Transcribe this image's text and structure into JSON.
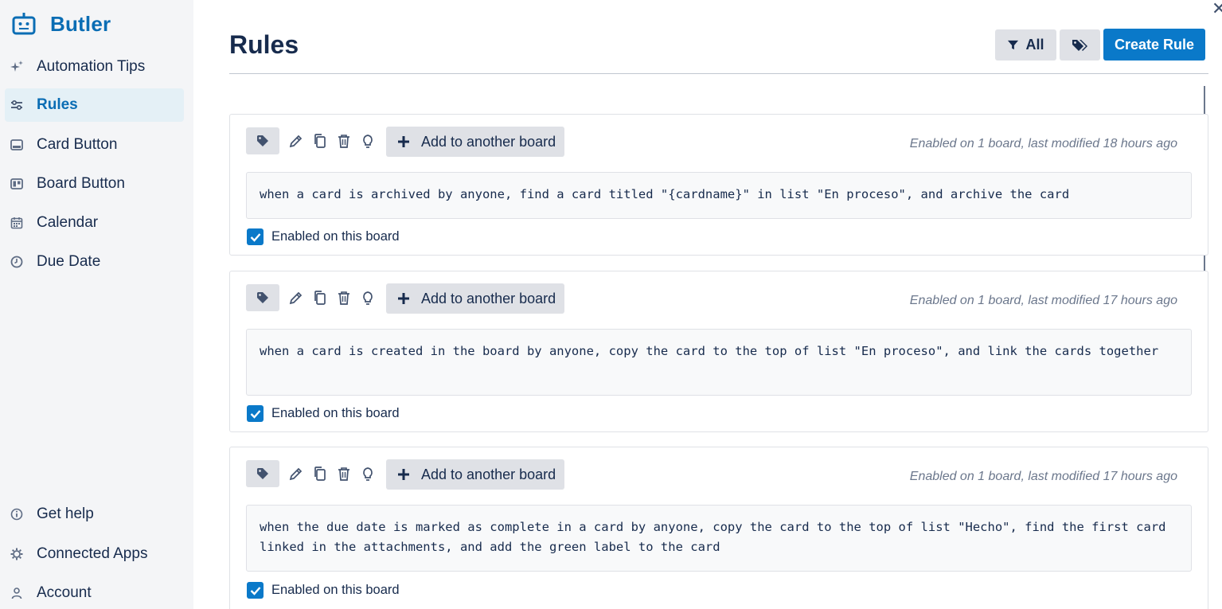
{
  "app": {
    "name": "Butler"
  },
  "sidebar": {
    "top_items": [
      {
        "label": "Automation Tips",
        "icon": "sparkles-icon"
      },
      {
        "label": "Rules",
        "icon": "sliders-icon",
        "active": true
      },
      {
        "label": "Card Button",
        "icon": "card-button-icon"
      },
      {
        "label": "Board Button",
        "icon": "board-button-icon"
      },
      {
        "label": "Calendar",
        "icon": "calendar-icon"
      },
      {
        "label": "Due Date",
        "icon": "clock-icon"
      }
    ],
    "bottom_items": [
      {
        "label": "Get help",
        "icon": "info-icon"
      },
      {
        "label": "Connected Apps",
        "icon": "gear-icon"
      },
      {
        "label": "Account",
        "icon": "person-icon"
      }
    ]
  },
  "header": {
    "title": "Rules",
    "filter_label": "All",
    "create_label": "Create Rule"
  },
  "rules": [
    {
      "add_label": "Add to another board",
      "meta": "Enabled on 1 board, last modified 18 hours ago",
      "text": "when a card is archived by anyone, find a card titled \"{cardname}\" in list \"En proceso\", and archive the card",
      "enabled_label": "Enabled on this board",
      "enabled": true
    },
    {
      "add_label": "Add to another board",
      "meta": "Enabled on 1 board, last modified 17 hours ago",
      "text": "when a card is created in the board by anyone, copy the card to the top of list \"En proceso\", and link the cards together",
      "enabled_label": "Enabled on this board",
      "enabled": true
    },
    {
      "add_label": "Add to another board",
      "meta": "Enabled on 1 board, last modified 17 hours ago",
      "text": "when the due date is marked as complete in a card by anyone, copy the card to the top of list \"Hecho\", find the first card linked in the attachments, and add the green label to the card",
      "enabled_label": "Enabled on this board",
      "enabled": true
    }
  ],
  "colors": {
    "brand": "#0a6db4",
    "primary_button": "#0a79c9",
    "sidebar_bg": "#f4f5f7"
  }
}
